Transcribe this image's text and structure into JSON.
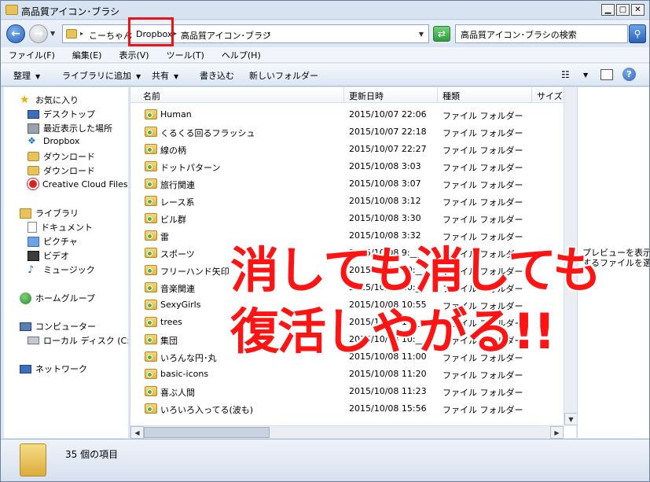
{
  "window": {
    "title": "高品質アイコン･ブラシ"
  },
  "address": {
    "crumbs": [
      "こーちゃん",
      "Dropbox",
      "高品質アイコン･ブラシ"
    ],
    "search_placeholder": "高品質アイコン･ブラシの検索"
  },
  "menu": [
    "ファイル(F)",
    "編集(E)",
    "表示(V)",
    "ツール(T)",
    "ヘルプ(H)"
  ],
  "toolbar": {
    "organize": "整理",
    "add_to_library": "ライブラリに追加",
    "share": "共有",
    "burn": "書き込む",
    "new_folder": "新しいフォルダー"
  },
  "nav": {
    "favorites": "お気に入り",
    "desktop": "デスクトップ",
    "recent": "最近表示した場所",
    "dropbox": "Dropbox",
    "downloads1": "ダウンロード",
    "downloads2": "ダウンロード",
    "creative_cloud": "Creative Cloud Files",
    "libraries": "ライブラリ",
    "documents": "ドキュメント",
    "pictures": "ピクチャ",
    "videos": "ビデオ",
    "music": "ミュージック",
    "homegroup": "ホームグループ",
    "computer": "コンピューター",
    "local_disk": "ローカル ディスク (C:)",
    "network": "ネットワーク"
  },
  "columns": {
    "name": "名前",
    "date": "更新日時",
    "type": "種類",
    "size": "サイズ"
  },
  "files": [
    {
      "name": "Human",
      "date": "2015/10/07 22:06",
      "type": "ファイル フォルダー"
    },
    {
      "name": "くるくる回るフラッシュ",
      "date": "2015/10/07 22:18",
      "type": "ファイル フォルダー"
    },
    {
      "name": "線の柄",
      "date": "2015/10/07 22:27",
      "type": "ファイル フォルダー"
    },
    {
      "name": "ドットパターン",
      "date": "2015/10/08 3:03",
      "type": "ファイル フォルダー"
    },
    {
      "name": "旅行関連",
      "date": "2015/10/08 3:07",
      "type": "ファイル フォルダー"
    },
    {
      "name": "レース系",
      "date": "2015/10/08 3:12",
      "type": "ファイル フォルダー"
    },
    {
      "name": "ビル群",
      "date": "2015/10/08 3:30",
      "type": "ファイル フォルダー"
    },
    {
      "name": "雷",
      "date": "2015/10/08 3:32",
      "type": "ファイル フォルダー"
    },
    {
      "name": "スポーツ",
      "date": "2015/10/08 9:__",
      "type": "ファイル フォルダー"
    },
    {
      "name": "フリーハンド矢印",
      "date": "2015/10/08 10:__",
      "type": "ファイル フォルダー"
    },
    {
      "name": "音楽関連",
      "date": "2015/10/08 10:__",
      "type": "ファイル フォルダー"
    },
    {
      "name": "SexyGirls",
      "date": "2015/10/08 10:55",
      "type": "ファイル フォルダー"
    },
    {
      "name": "trees",
      "date": "2015/10/08 10:__",
      "type": "ファイル フォルダー"
    },
    {
      "name": "集団",
      "date": "2015/10/08 10:__",
      "type": "ファイル フォルダー"
    },
    {
      "name": "いろんな円･丸",
      "date": "2015/10/08 11:00",
      "type": "ファイル フォルダー"
    },
    {
      "name": "basic-icons",
      "date": "2015/10/08 11:20",
      "type": "ファイル フォルダー"
    },
    {
      "name": "喜ぶ人間",
      "date": "2015/10/08 11:23",
      "type": "ファイル フォルダー"
    },
    {
      "name": "いろいろ入ってる(波も)",
      "date": "2015/10/08 15:56",
      "type": "ファイル フォルダー"
    }
  ],
  "preview": {
    "line1": "プレビューを表示",
    "line2": "するファイルを選"
  },
  "status": {
    "count": "35 個の項目"
  },
  "caption": {
    "line1": "消しても消しても",
    "line2": "復活しやがる!!"
  },
  "colors": {
    "highlight_box": "#e8141a",
    "caption": "#ff1414"
  }
}
